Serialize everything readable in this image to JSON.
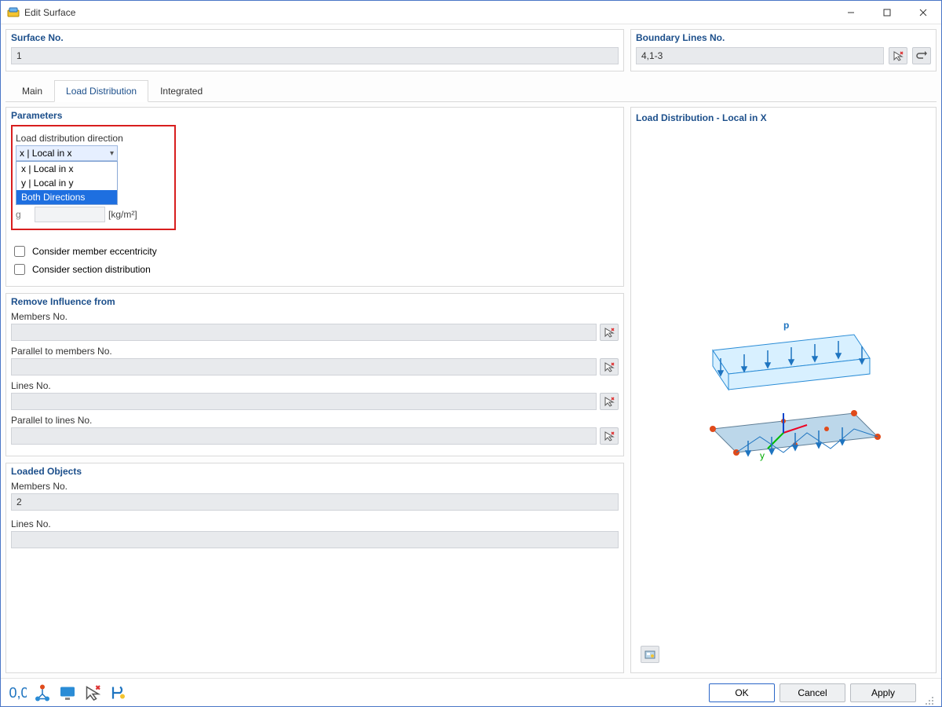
{
  "window": {
    "title": "Edit Surface"
  },
  "top": {
    "surface": {
      "label": "Surface No.",
      "value": "1"
    },
    "boundary": {
      "label": "Boundary Lines No.",
      "value": "4,1-3"
    }
  },
  "tabs": {
    "items": [
      "Main",
      "Load Distribution",
      "Integrated"
    ],
    "active": 1
  },
  "parameters": {
    "legend": "Parameters",
    "direction_label": "Load distribution direction",
    "direction_selected": "x | Local in x",
    "direction_options": [
      "x | Local in x",
      "y | Local in y",
      "Both Directions"
    ],
    "direction_highlight": 2,
    "g_label": "g",
    "unit": "[kg/m²]",
    "check_eccentricity": "Consider member eccentricity",
    "check_section": "Consider section distribution"
  },
  "remove": {
    "legend": "Remove Influence from",
    "groups": [
      {
        "label": "Members No.",
        "value": ""
      },
      {
        "label": "Parallel to members No.",
        "value": ""
      },
      {
        "label": "Lines No.",
        "value": ""
      },
      {
        "label": "Parallel to lines No.",
        "value": ""
      }
    ]
  },
  "loaded": {
    "legend": "Loaded Objects",
    "members_label": "Members No.",
    "members_value": "2",
    "lines_label": "Lines No.",
    "lines_value": ""
  },
  "preview": {
    "legend": "Load Distribution - Local in X",
    "p_label": "p",
    "y_label": "y"
  },
  "footer": {
    "ok": "OK",
    "cancel": "Cancel",
    "apply": "Apply"
  }
}
